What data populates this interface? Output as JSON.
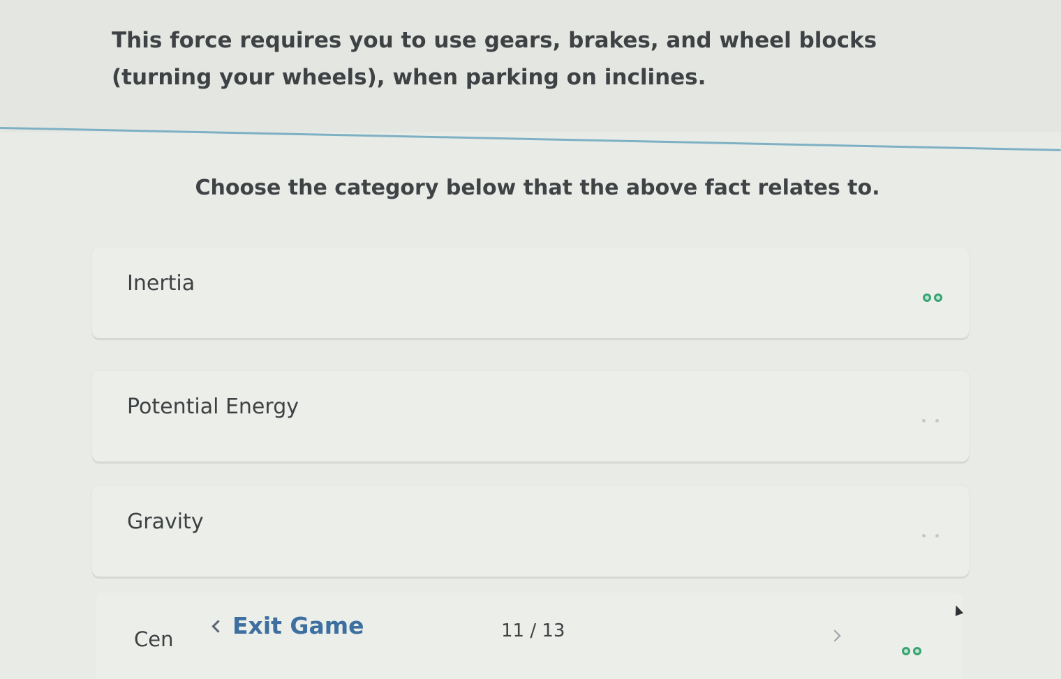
{
  "fact": {
    "text": "This force requires you to use gears, brakes, and wheel blocks (turning your wheels), when parking on inclines."
  },
  "prompt": "Choose the category below that the above fact relates to.",
  "options": [
    {
      "label": "Inertia",
      "mastery": "filled"
    },
    {
      "label": "Potential Energy",
      "mastery": "empty"
    },
    {
      "label": "Gravity",
      "mastery": "empty"
    },
    {
      "label": "Cen",
      "mastery": "filled"
    }
  ],
  "footer": {
    "exit_label": "Exit Game",
    "counter": "11 / 13"
  },
  "colors": {
    "accent": "#3d6fa0",
    "mastery_green": "#3aa374",
    "divider": "#7eb0c4"
  }
}
